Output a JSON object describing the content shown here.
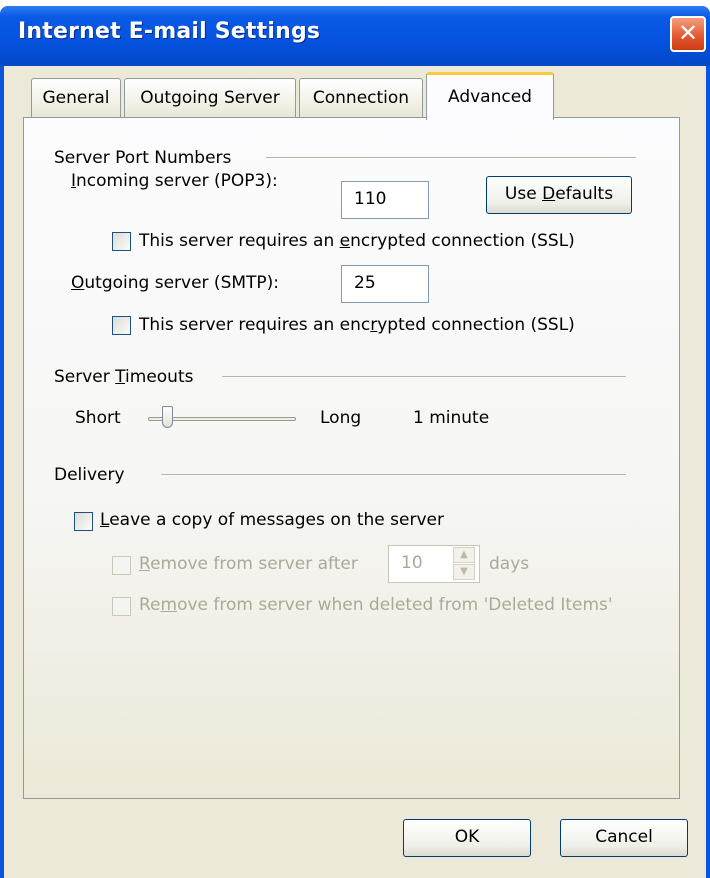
{
  "window": {
    "title": "Internet E-mail Settings",
    "close_glyph": "✕"
  },
  "tabs": [
    {
      "label": "General"
    },
    {
      "label": "Outgoing Server"
    },
    {
      "label": "Connection"
    },
    {
      "label": "Advanced",
      "active": true
    }
  ],
  "server_ports": {
    "group_label": "Server Port Numbers",
    "incoming_label_prefix": "",
    "incoming_label_hotkey": "I",
    "incoming_label_rest": "ncoming server (POP3):",
    "incoming_value": "110",
    "use_defaults_prefix": "Use ",
    "use_defaults_hotkey": "D",
    "use_defaults_rest": "efaults",
    "incoming_ssl_prefix": "This server requires an ",
    "incoming_ssl_hotkey": "e",
    "incoming_ssl_rest": "ncrypted connection (SSL)",
    "outgoing_label_hotkey": "O",
    "outgoing_label_rest": "utgoing server (SMTP):",
    "outgoing_value": "25",
    "outgoing_ssl_prefix": "This server requires an enc",
    "outgoing_ssl_hotkey": "r",
    "outgoing_ssl_rest": "ypted connection (SSL)"
  },
  "timeouts": {
    "group_label_prefix": "Server ",
    "group_label_hotkey": "T",
    "group_label_rest": "imeouts",
    "short_label": "Short",
    "long_label": "Long",
    "value_text": "1 minute",
    "slider_fraction": 0.1
  },
  "delivery": {
    "group_label": "Delivery",
    "leave_copy_hotkey": "L",
    "leave_copy_rest": "eave a copy of messages on the server",
    "remove_after_prefix": "",
    "remove_after_hotkey": "R",
    "remove_after_rest": "emove from server after",
    "remove_days_value": "10",
    "days_label": "days",
    "remove_deleted_prefix": "Re",
    "remove_deleted_hotkey": "m",
    "remove_deleted_rest": "ove from server when deleted from 'Deleted Items'"
  },
  "buttons": {
    "ok_label": "OK",
    "cancel_label": "Cancel"
  },
  "icons": {
    "spin_up": "▲",
    "spin_down": "▼"
  },
  "colors": {
    "title_bar": "#0553e0",
    "dialog_bg": "#ece9d8",
    "close_button": "#e3552c",
    "active_tab_accent": "#ffc83c"
  }
}
